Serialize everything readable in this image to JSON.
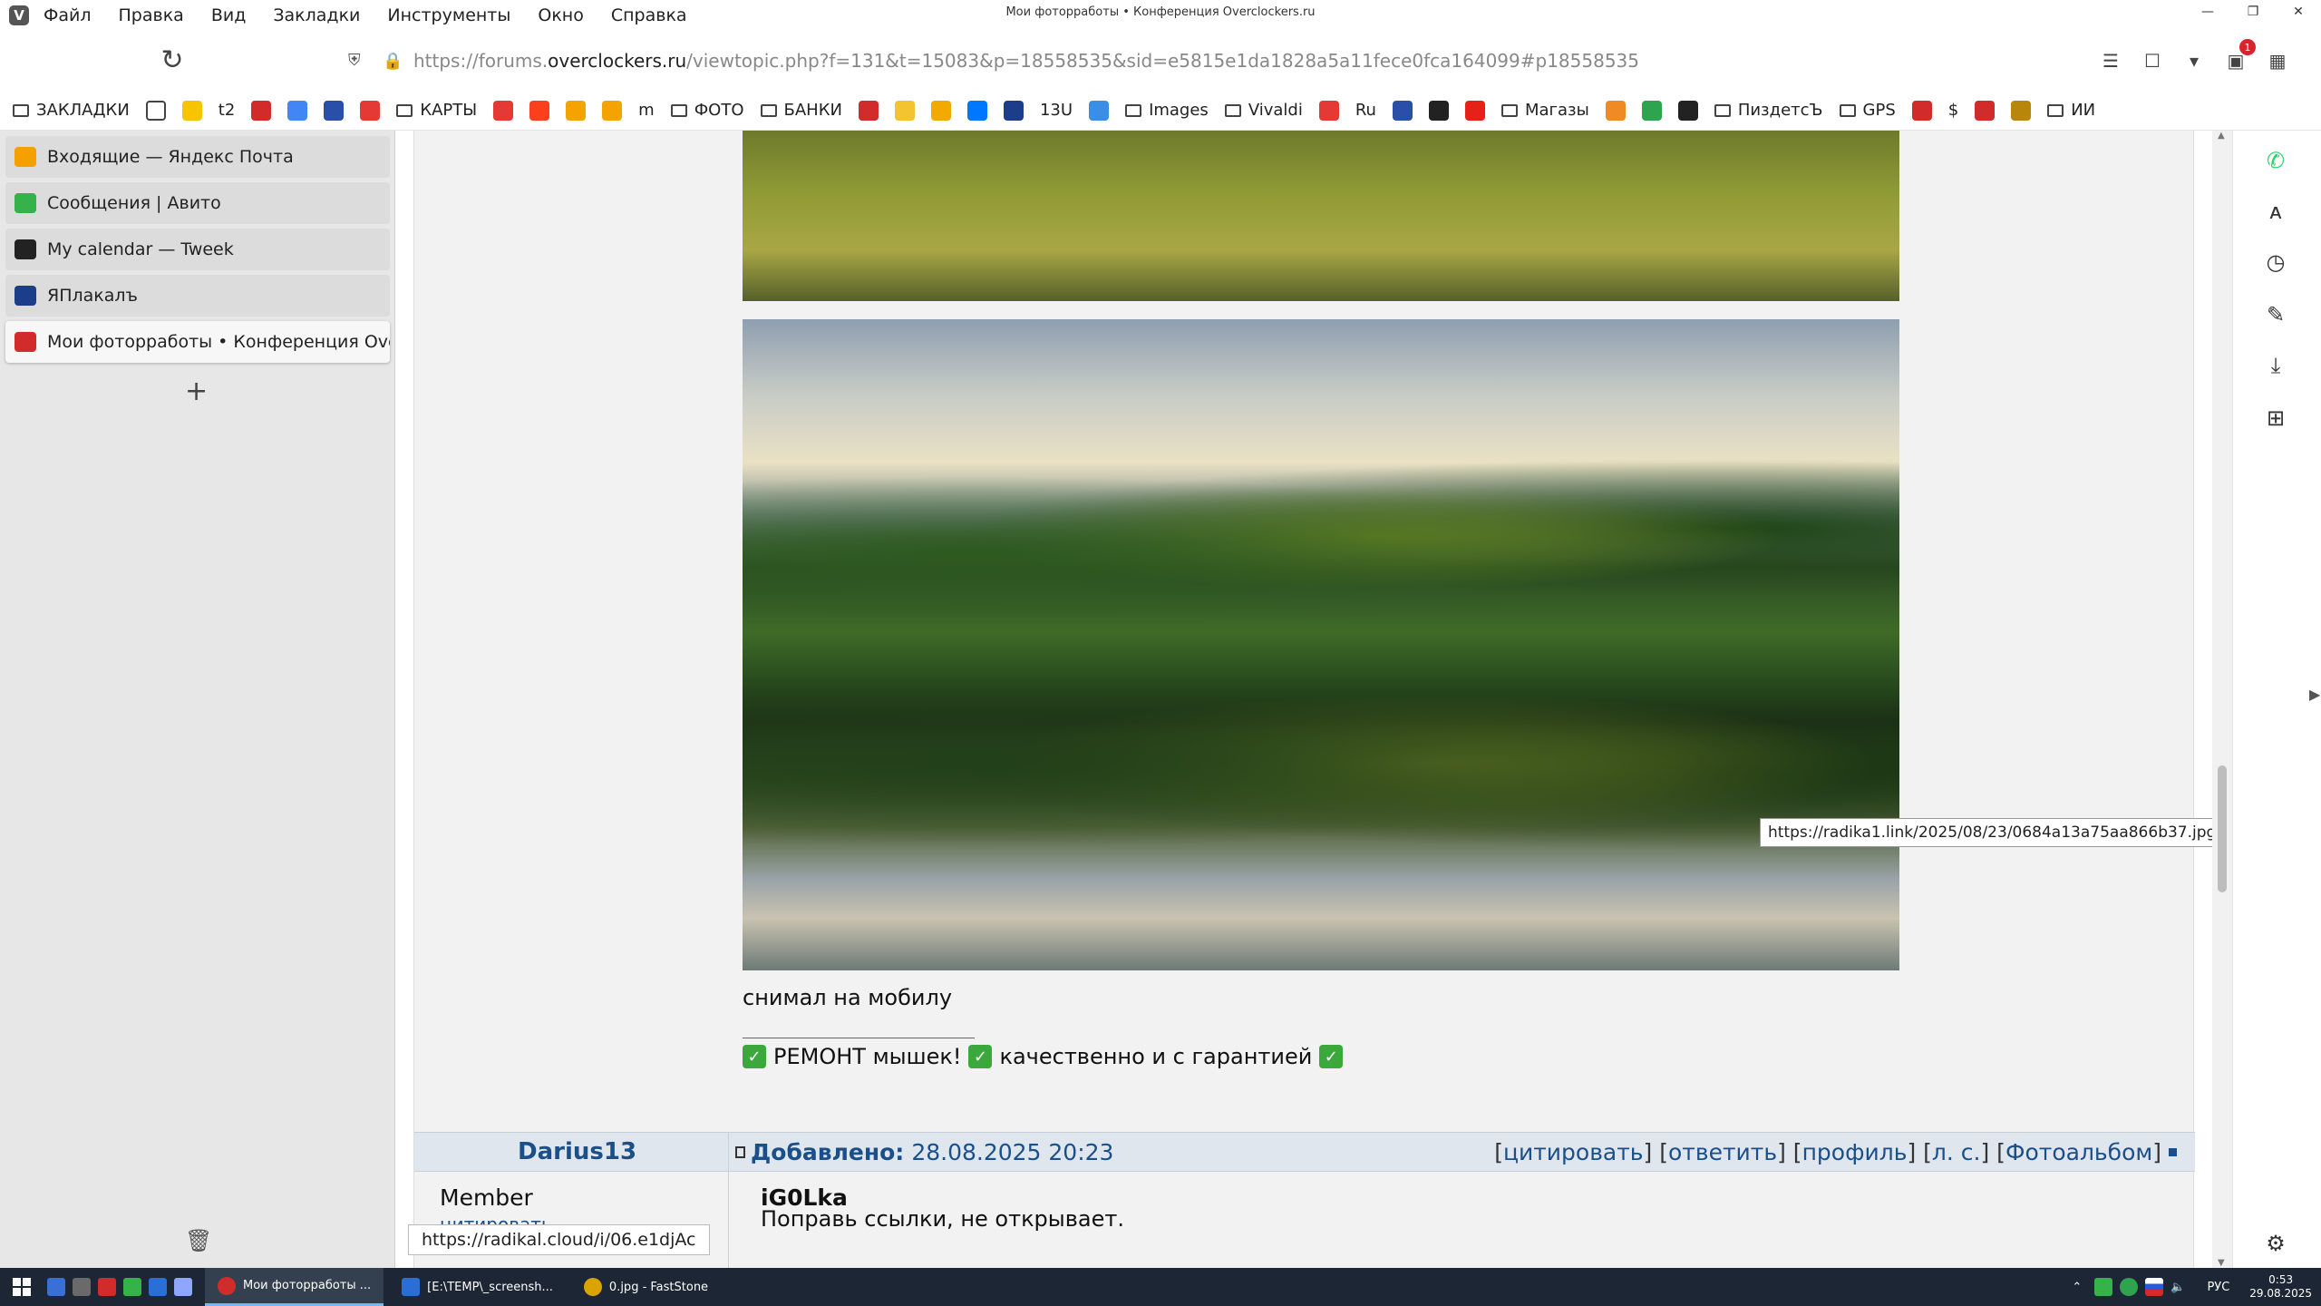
{
  "window": {
    "title": "Мои фоторработы • Конференция Overclockers.ru"
  },
  "menu": [
    "Файл",
    "Правка",
    "Вид",
    "Закладки",
    "Инструменты",
    "Окно",
    "Справка"
  ],
  "address": {
    "prefix": "https://forums.",
    "host": "overclockers.ru",
    "path": "/viewtopic.php?f=131&t=15083&p=18558535&sid=e5815e1da1828a5a11fece0fca164099#p18558535",
    "extensions_badge": "1"
  },
  "bookmarks": [
    {
      "type": "folder",
      "label": "ЗАКЛАДКИ"
    },
    {
      "type": "icon",
      "icon": "page-icon",
      "color": "#ffffff"
    },
    {
      "type": "icon",
      "icon": "beeline-icon",
      "color": "#f6c500"
    },
    {
      "type": "text",
      "label": "t2"
    },
    {
      "type": "icon",
      "icon": "overclockers-icon",
      "color": "#d22b2b"
    },
    {
      "type": "icon",
      "icon": "google-icon",
      "color": "#4285f4"
    },
    {
      "type": "icon",
      "icon": "calendar-icon",
      "color": "#2a4fa8"
    },
    {
      "type": "icon",
      "icon": "maps-pin-icon",
      "color": "#e53935"
    },
    {
      "type": "folder",
      "label": "КАРТЫ"
    },
    {
      "type": "icon",
      "icon": "pin-icon",
      "color": "#e53935"
    },
    {
      "type": "icon",
      "icon": "yandex-icon",
      "color": "#fc3f1d"
    },
    {
      "type": "icon",
      "icon": "photo-icon",
      "color": "#f4a300"
    },
    {
      "type": "icon",
      "icon": "mail-icon",
      "color": "#f4a300"
    },
    {
      "type": "text",
      "label": "m"
    },
    {
      "type": "folder",
      "label": "ФОТО"
    },
    {
      "type": "folder",
      "label": "БАНКИ"
    },
    {
      "type": "icon",
      "icon": "overclockers-icon",
      "color": "#d22b2b"
    },
    {
      "type": "icon",
      "icon": "brand-icon",
      "color": "#f4c430"
    },
    {
      "type": "icon",
      "icon": "pencil-icon",
      "color": "#f2a900"
    },
    {
      "type": "icon",
      "icon": "vk-icon",
      "color": "#0077ff"
    },
    {
      "type": "icon",
      "icon": "yaplakal-icon",
      "color": "#1c3d8a"
    },
    {
      "type": "text",
      "label": "13U"
    },
    {
      "type": "icon",
      "icon": "gear-blue-icon",
      "color": "#3a8ee6"
    },
    {
      "type": "folder",
      "label": "Images"
    },
    {
      "type": "folder",
      "label": "Vivaldi"
    },
    {
      "type": "icon",
      "icon": "ru-icon",
      "color": "#e53935"
    },
    {
      "type": "text",
      "label": "Ru"
    },
    {
      "type": "icon",
      "icon": "p-icon",
      "color": "#2a4fa8"
    },
    {
      "type": "icon",
      "icon": "r-icon",
      "color": "#222222"
    },
    {
      "type": "icon",
      "icon": "youtube-icon",
      "color": "#e62117"
    },
    {
      "type": "folder",
      "label": "Магазы"
    },
    {
      "type": "icon",
      "icon": "search-color-icon",
      "color": "#f08a24"
    },
    {
      "type": "icon",
      "icon": "dots-icon",
      "color": "#2ea44f"
    },
    {
      "type": "icon",
      "icon": "tweek-icon",
      "color": "#222222"
    },
    {
      "type": "folder",
      "label": "ПиздетсЪ"
    },
    {
      "type": "folder",
      "label": "GPS"
    },
    {
      "type": "icon",
      "icon": "f-icon",
      "color": "#d22b2b"
    },
    {
      "type": "text",
      "label": "$"
    },
    {
      "type": "icon",
      "icon": "speedometer-icon",
      "color": "#d22b2b"
    },
    {
      "type": "icon",
      "icon": "link-icon",
      "color": "#b8860b"
    },
    {
      "type": "folder",
      "label": "ИИ"
    }
  ],
  "tabs": [
    {
      "label": "Входящие — Яндекс Почта",
      "color": "#f6a000",
      "active": false
    },
    {
      "label": "Сообщения | Авито",
      "color": "#35b34a",
      "active": false
    },
    {
      "label": "My calendar — Tweek",
      "color": "#222222",
      "active": false
    },
    {
      "label": "ЯПлакалъ",
      "color": "#1c3d8a",
      "active": false
    },
    {
      "label": "Мои фоторработы • Конференция Overclockers.ru",
      "color": "#d22b2b",
      "active": true
    }
  ],
  "status_link": "https://radikal.cloud/i/06.e1djAc",
  "post": {
    "image_tooltip": "https://radika1.link/2025/08/23/0684a13a75aa866b37.jpg",
    "caption": "снимал на мобилу",
    "signature": [
      "РЕМОНТ мышек!",
      "качественно и с гарантией"
    ]
  },
  "next_post": {
    "author": "Darius13",
    "added_label": "Добавлено:",
    "added_date": "28.08.2025 20:23",
    "actions": [
      "цитировать",
      "ответить",
      "профиль",
      "л. с.",
      "Фотоальбом"
    ],
    "rank": "Member",
    "left_link": "цитировать",
    "quote_author": "iG0Lka",
    "quote_text": "Поправь ссылки, не открывает."
  },
  "right_panel_icons": [
    "whatsapp-icon",
    "translate-icon",
    "history-icon",
    "notes-icon",
    "downloads-icon",
    "add-panel-icon",
    "settings-icon"
  ],
  "taskbar": {
    "tasks": [
      {
        "label": "Мои фоторработы ...",
        "active": true,
        "color": "#d22b2b"
      },
      {
        "label": "[E:\\TEMP\\_screensh...",
        "active": false,
        "color": "#2a6fd6"
      },
      {
        "label": "0.jpg - FastStone",
        "active": false,
        "color": "#d9a400"
      }
    ],
    "lang": "РУС",
    "time": "0:53",
    "date": "29.08.2025"
  }
}
